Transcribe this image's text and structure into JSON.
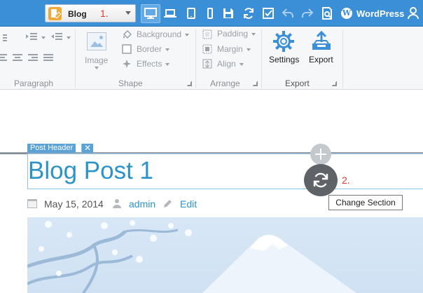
{
  "toolbar": {
    "page_select_value": "Blog",
    "wordpress_label": "WordPress"
  },
  "markers": {
    "one": "1.",
    "two": "2."
  },
  "ribbon": {
    "paragraph_group": "Paragraph",
    "shape_group": "Shape",
    "arrange_group": "Arrange",
    "export_group": "Export",
    "image_label": "Image",
    "background_label": "Background",
    "border_label": "Border",
    "effects_label": "Effects",
    "padding_label": "Padding",
    "margin_label": "Margin",
    "align_label": "Align",
    "settings_label": "Settings",
    "export_label": "Export"
  },
  "canvas": {
    "section_tag": "Post Header",
    "section_tag_close": "✕",
    "post_title": "Blog Post 1",
    "post_date": "May 15, 2014",
    "post_author": "admin",
    "post_edit": "Edit",
    "change_section_tooltip": "Change Section"
  },
  "colors": {
    "topbar": "#3b8fd6",
    "accent_link": "#2c93c8",
    "marker_red": "#e03a2e"
  }
}
